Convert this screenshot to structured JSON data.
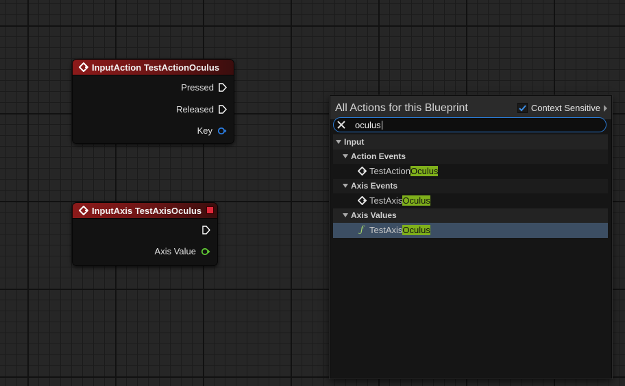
{
  "nodes": {
    "action": {
      "title": "InputAction TestActionOculus",
      "pins": [
        "Pressed",
        "Released",
        "Key"
      ]
    },
    "axis": {
      "title": "InputAxis TestAxisOculus",
      "pins": [
        "Axis Value"
      ]
    }
  },
  "menu": {
    "title": "All Actions for this Blueprint",
    "context_sensitive_label": "Context Sensitive",
    "context_sensitive_checked": true,
    "search_value": "oculus",
    "tree": {
      "input": "Input",
      "action_events": "Action Events",
      "action_item_prefix": "TestAction",
      "action_item_match": "Oculus",
      "axis_events": "Axis Events",
      "axis_event_prefix": "TestAxis",
      "axis_event_match": "Oculus",
      "axis_values": "Axis Values",
      "axis_value_prefix": "TestAxis",
      "axis_value_match": "Oculus"
    }
  },
  "colors": {
    "node_header": "#8c1a1a",
    "exec_pin": "#ffffff",
    "key_pin": "#2b7ce0",
    "axis_pin": "#5fc634",
    "search_border": "#2a7bd6",
    "match_highlight": "#7fb01b",
    "selection": "#3c4e63"
  }
}
